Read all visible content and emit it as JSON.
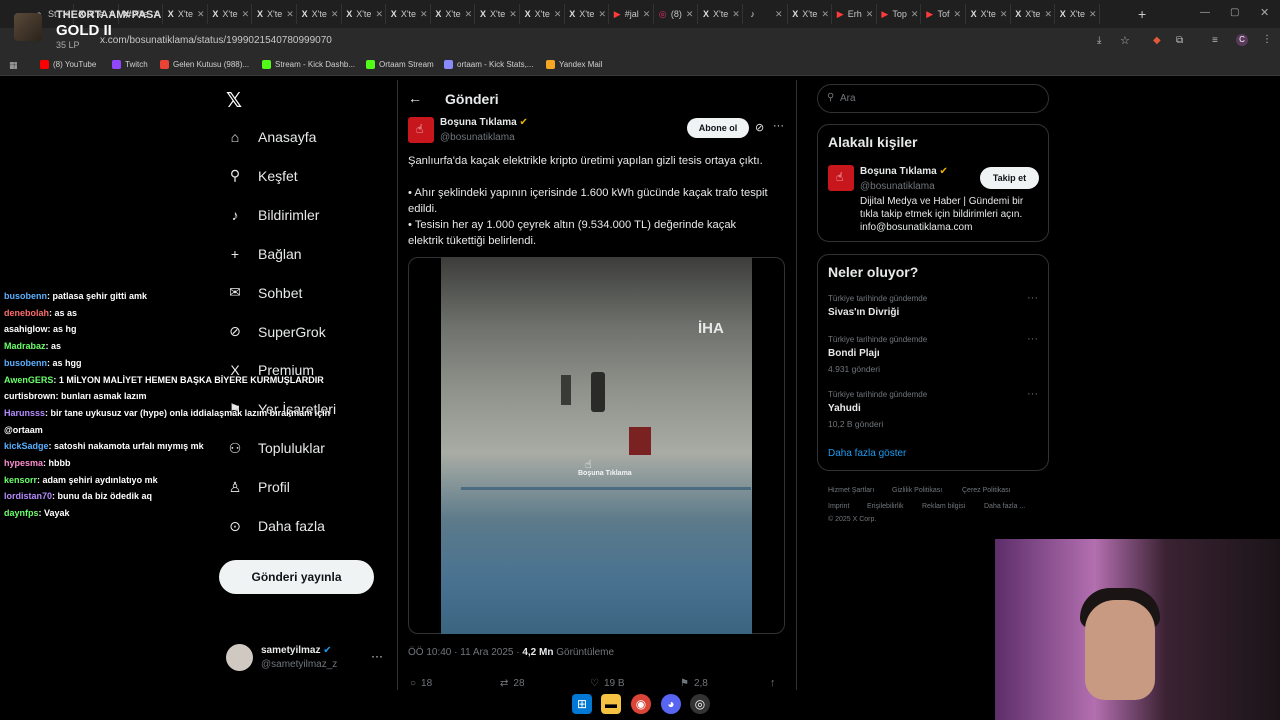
{
  "browser": {
    "tabs": [
      {
        "label": "St",
        "icon": "stream-icon"
      },
      {
        "label": "X'te",
        "icon": "x-icon"
      },
      {
        "label": "X'te",
        "icon": "x-icon"
      },
      {
        "label": "X'te",
        "icon": "x-icon"
      },
      {
        "label": "X'te",
        "icon": "x-icon"
      },
      {
        "label": "X'te",
        "icon": "x-icon"
      },
      {
        "label": "X'te",
        "icon": "x-icon"
      },
      {
        "label": "X'te",
        "icon": "x-icon"
      },
      {
        "label": "X'te",
        "icon": "x-icon"
      },
      {
        "label": "X'te",
        "icon": "x-icon"
      },
      {
        "label": "X'te",
        "icon": "x-icon"
      },
      {
        "label": "X'te",
        "icon": "x-icon"
      },
      {
        "label": "X'te",
        "icon": "x-icon"
      },
      {
        "label": "#jal",
        "icon": "youtube-icon"
      },
      {
        "label": "(8)",
        "icon": "instagram-icon"
      },
      {
        "label": "X'te",
        "icon": "x-icon"
      },
      {
        "label": "",
        "icon": "active-tab-audio-icon"
      },
      {
        "label": "X'te",
        "icon": "x-icon"
      },
      {
        "label": "Erh",
        "icon": "youtube-icon"
      },
      {
        "label": "Top",
        "icon": "youtube-icon"
      },
      {
        "label": "Tof",
        "icon": "youtube-icon"
      },
      {
        "label": "X'te",
        "icon": "x-icon"
      },
      {
        "label": "X'te",
        "icon": "x-icon"
      },
      {
        "label": "X'te",
        "icon": "x-icon"
      }
    ],
    "url": "x.com/bosunatiklama/status/1999021540780999070",
    "bookmarks": [
      {
        "label": "(8) YouTube",
        "color": "#ff0000"
      },
      {
        "label": "Twitch",
        "color": "#9146ff"
      },
      {
        "label": "Gelen Kutusu (988)...",
        "color": "#ea4335"
      },
      {
        "label": "Stream - Kick Dashb...",
        "color": "#53fc18"
      },
      {
        "label": "Ortaam Stream",
        "color": "#53fc18"
      },
      {
        "label": "ortaam - Kick Stats,...",
        "color": "#8a8aff"
      },
      {
        "label": "Yandex Mail",
        "color": "#f5a623"
      }
    ]
  },
  "overlay": {
    "streamer": "THEORTAAM#PASA",
    "rank": "GOLD II",
    "lp": "35 LP"
  },
  "nav": {
    "items": [
      {
        "label": "Anasayfa",
        "icon": "home-icon"
      },
      {
        "label": "Keşfet",
        "icon": "search-icon"
      },
      {
        "label": "Bildirimler",
        "icon": "bell-icon"
      },
      {
        "label": "Bağlan",
        "icon": "add-user-icon"
      },
      {
        "label": "Sohbet",
        "icon": "mail-icon"
      },
      {
        "label": "SuperGrok",
        "icon": "grok-icon"
      },
      {
        "label": "Premium",
        "icon": "x-icon"
      },
      {
        "label": "Yer İşaretleri",
        "icon": "bookmark-icon"
      },
      {
        "label": "Topluluklar",
        "icon": "communities-icon"
      },
      {
        "label": "Profil",
        "icon": "profile-icon"
      },
      {
        "label": "Daha fazla",
        "icon": "more-circle-icon"
      }
    ],
    "post_button": "Gönderi yayınla",
    "account": {
      "name": "sametyilmaz",
      "handle": "@sametyilmaz_z"
    }
  },
  "post": {
    "header": "Gönderi",
    "author": "Boşuna Tıklama",
    "handle": "@bosunatiklama",
    "subscribe": "Abone ol",
    "lines": [
      "Şanlıurfa'da kaçak elektrikle kripto üretimi yapılan gizli tesis ortaya çıktı.",
      "",
      "• Ahır şeklindeki yapının içerisinde 1.600 kWh gücünde kaçak trafo tespit",
      "edildi.",
      "• Tesisin her ay 1.000 çeyrek altın (9.534.000 TL) değerinde kaçak",
      "elektrik tükettiği belirlendi."
    ],
    "media_logo": "İHA",
    "media_watermark": "Boşuna Tıklama",
    "time": "ÖÖ 10:40 · 11 Ara 2025 ·",
    "views": "4,2 Mn",
    "views_label": "Görüntüleme",
    "actions": [
      "18",
      "28",
      "19 B",
      "2,8"
    ]
  },
  "right": {
    "search_placeholder": "Ara",
    "related_title": "Alakalı kişiler",
    "related": {
      "name": "Boşuna Tıklama",
      "handle": "@bosunatiklama",
      "follow": "Takip et",
      "bio": [
        "Dijital Medya ve Haber | Gündemi bir",
        "tıkla takip etmek için bildirimleri açın.",
        "info@bosunatiklama.com"
      ]
    },
    "trends_title": "Neler oluyor?",
    "trends": [
      {
        "category": "Türkiye tarihinde gündemde",
        "title": "Sivas'ın Divriği",
        "count": ""
      },
      {
        "category": "Türkiye tarihinde gündemde",
        "title": "Bondi Plajı",
        "count": "4.931 gönderi"
      },
      {
        "category": "Türkiye tarihinde gündemde",
        "title": "Yahudi",
        "count": "10,2 B gönderi"
      }
    ],
    "show_more": "Daha fazla göster",
    "footer1": [
      "Hizmet Şartları",
      "Gizlilik Politikası",
      "Çerez Politikası"
    ],
    "footer2": [
      "Imprint",
      "Erişilebilirlik",
      "Reklam bilgisi",
      "Daha fazla ..."
    ],
    "copyright": "© 2025 X Corp."
  },
  "chat": [
    {
      "user": "busobenn",
      "msg": ": patlasa şehir gitti amk",
      "color": "#5ab0ff"
    },
    {
      "user": "denebolah",
      "msg": ": as as",
      "color": "#ff6b6b"
    },
    {
      "user": "asahiglow",
      "msg": ": as hg",
      "color": "#ffffff"
    },
    {
      "user": "Madrabaz",
      "msg": ": as",
      "color": "#6bff6b"
    },
    {
      "user": "busobenn",
      "msg": ": as hgg",
      "color": "#5ab0ff"
    },
    {
      "user": "AwenGERS",
      "msg": ": 1 MİLYON MALİYET HEMEN BAŞKA BİYERE KURMUŞLARDIR",
      "color": "#6bff6b"
    },
    {
      "user": "curtisbrown",
      "msg": ": bunları asmak lazım",
      "color": "#ffffff"
    },
    {
      "user": "Harunsss",
      "msg": ": bir tane uykusuz var (hype) onla iddialaşmak lazım bırakmam için",
      "color": "#b48cff"
    },
    {
      "user": "",
      "msg": "@ortaam",
      "color": "#ffffff"
    },
    {
      "user": "kickSadge",
      "msg": ": satoshi nakamota urfalı mıymış mk",
      "color": "#5ab0ff"
    },
    {
      "user": "hypesma",
      "msg": ": hbbb",
      "color": "#ff8cd0"
    },
    {
      "user": "kensorr",
      "msg": ": adam şehiri aydınlatıyo mk",
      "color": "#6bff6b"
    },
    {
      "user": "lordistan70",
      "msg": ": bunu da biz ödedik aq",
      "color": "#b48cff"
    },
    {
      "user": "daynfps",
      "msg": ": Vayak",
      "color": "#6bff6b"
    }
  ],
  "colors": {
    "accent": "#1d9bf0",
    "verified": "#e8b400",
    "brand_red": "#c8161d"
  }
}
